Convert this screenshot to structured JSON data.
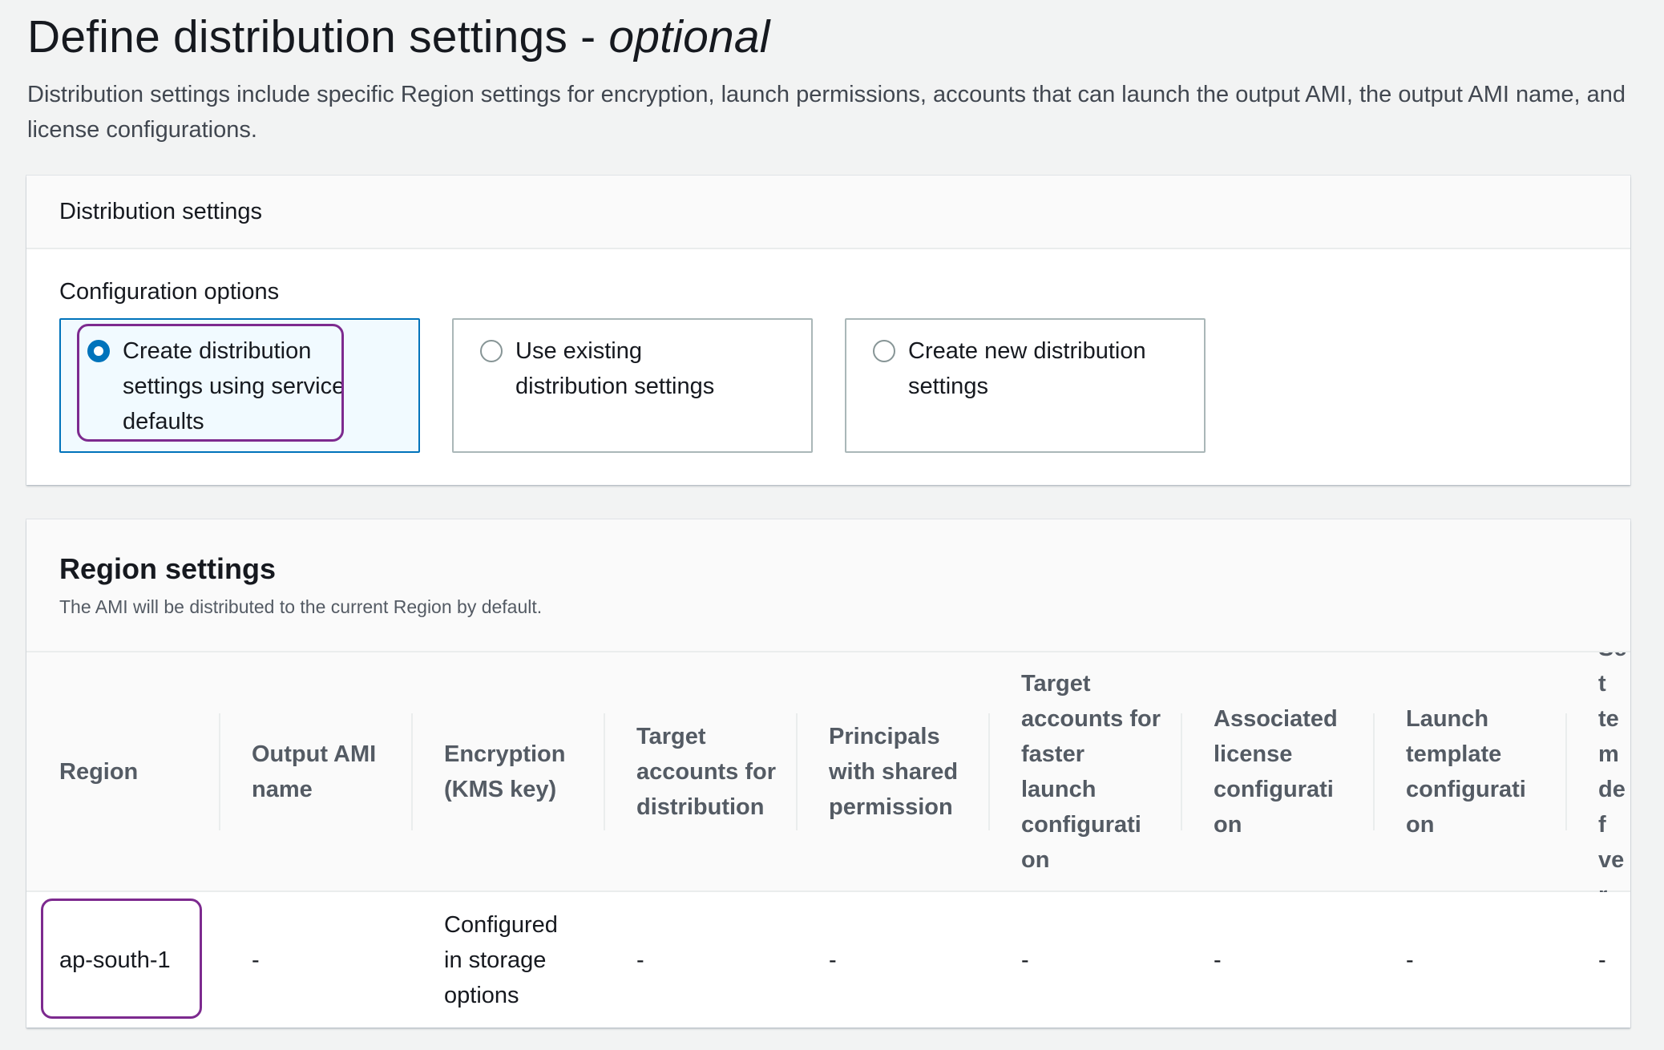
{
  "page": {
    "title_main": "Define distribution settings - ",
    "title_optional": "optional",
    "description": "Distribution settings include specific Region settings for encryption, launch permissions, accounts that can launch the output AMI, the output AMI name, and license configurations."
  },
  "distribution_settings": {
    "header": "Distribution settings",
    "config_label": "Configuration options",
    "options": [
      {
        "label": "Create distribution settings using service defaults",
        "selected": true
      },
      {
        "label": "Use existing distribution settings",
        "selected": false
      },
      {
        "label": "Create new distribution settings",
        "selected": false
      }
    ]
  },
  "region_settings": {
    "title": "Region settings",
    "subtitle": "The AMI will be distributed to the current Region by default.",
    "columns": [
      "Region",
      "Output AMI name",
      "Encryption (KMS key)",
      "Target accounts for distribution",
      "Principals with shared permission",
      "Target accounts for faster launch configurati on",
      "Associated license configurati on",
      "Launch template configurati on",
      "Set tem def ver"
    ],
    "rows": [
      [
        "ap-south-1",
        "-",
        "Configured in storage options",
        "-",
        "-",
        "-",
        "-",
        "-",
        "-"
      ]
    ]
  },
  "colors": {
    "accent": "#0073bb",
    "highlight": "#7d2a8f",
    "background": "#f2f3f3"
  }
}
